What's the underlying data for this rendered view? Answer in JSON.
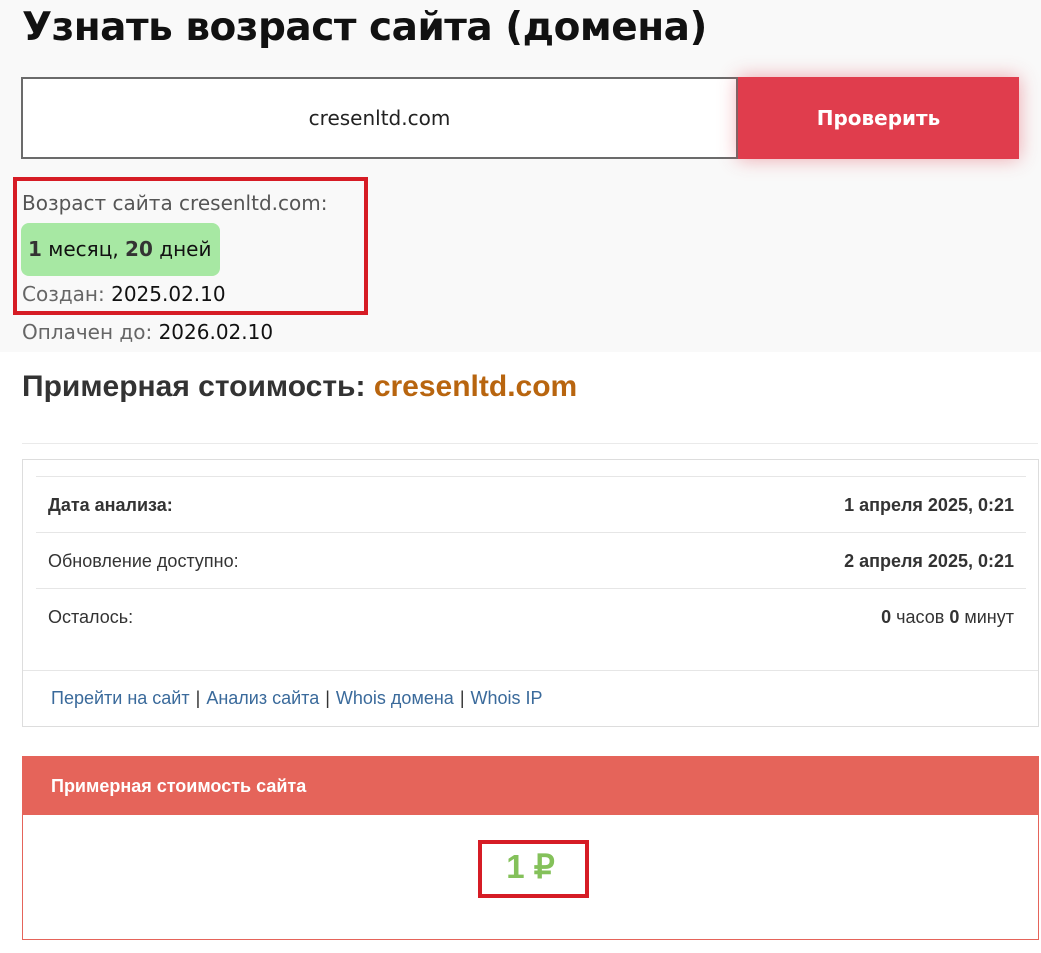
{
  "page_title": "Узнать возраст сайта (домена)",
  "search": {
    "value": "cresenltd.com",
    "button_label": "Проверить"
  },
  "age": {
    "label": "Возраст сайта cresenltd.com:",
    "months": "1",
    "months_unit": "месяц,",
    "days": "20",
    "days_unit": "дней",
    "created_label": "Создан:",
    "created_value": "2025.02.10",
    "paid_label": "Оплачен до:",
    "paid_value": "2026.02.10"
  },
  "cost": {
    "heading": "Примерная стоимость:",
    "domain": "cresenltd.com"
  },
  "stats": {
    "rows": [
      {
        "label": "Дата анализа:",
        "value_bold": "1 апреля 2025, 0:21"
      },
      {
        "label": "Обновление доступно:",
        "value_bold": "2 апреля 2025, 0:21"
      },
      {
        "label": "Осталось:",
        "hours": "0",
        "hours_unit": "часов",
        "minutes": "0",
        "minutes_unit": "минут"
      }
    ],
    "links": [
      "Перейти на сайт",
      "Анализ сайта",
      "Whois домена",
      "Whois IP"
    ],
    "link_separator": "|"
  },
  "price_panel": {
    "title": "Примерная стоимость сайта",
    "value": "1 ₽"
  },
  "colors": {
    "button": "#e03d4d",
    "age_badge": "#a7e8a3",
    "domain_accent": "#b8650f",
    "price_header": "#e5645a",
    "price_value": "#84c15a",
    "highlight": "#d61c25",
    "link": "#3a6a9b"
  }
}
